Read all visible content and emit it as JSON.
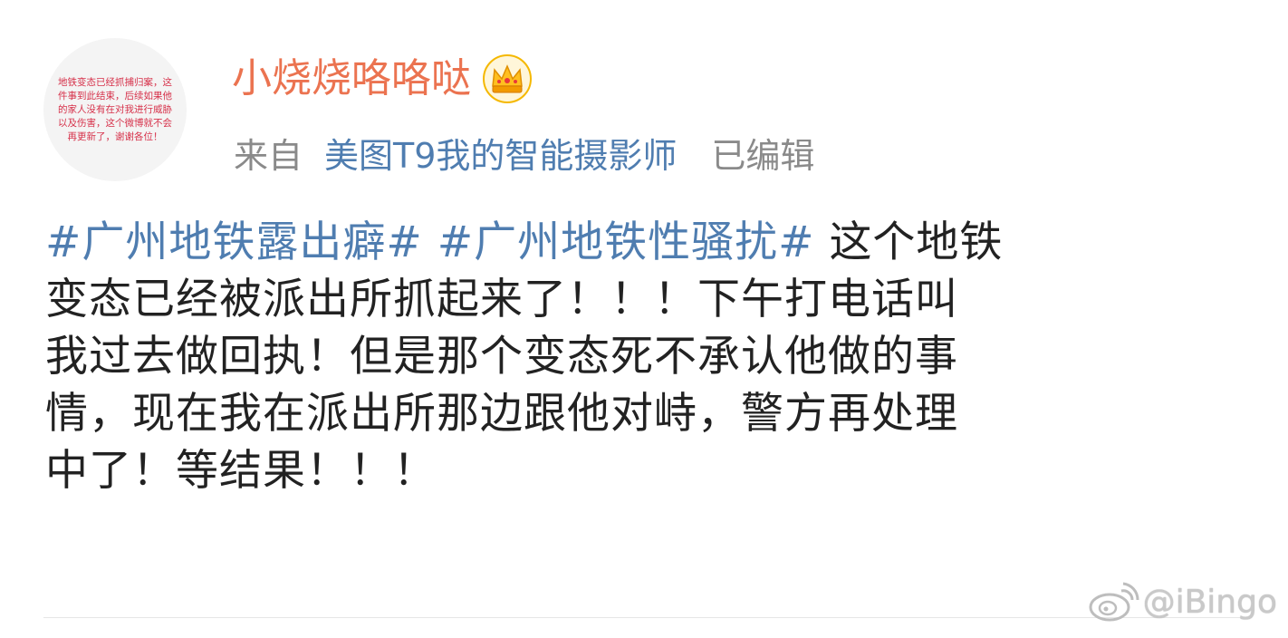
{
  "user": {
    "avatar_text": "地铁变态已经抓捕归案，这件事到此结束，后续如果他的家人没有在对我进行威胁以及伤害，这个微博就不会再更新了，谢谢各位！",
    "name": "小烧烧咯咯哒",
    "badge_icon": "crown-icon"
  },
  "meta": {
    "source_prefix": "来自",
    "source_app": "美图T9我的智能摄影师",
    "edited_label": "已编辑"
  },
  "post": {
    "line1": {
      "tag1": "#广州地铁露出癖#",
      "tag2": "#广州地铁性骚扰#",
      "text": "这个地铁"
    },
    "line2": "变态已经被派出所抓起来了！！！下午打电话叫",
    "line3": "我过去做回执！但是那个变态死不承认他做的事",
    "line4": "情，现在我在派出所那边跟他对峙，警方再处理",
    "line5": "中了！等结果！！！"
  },
  "watermark": {
    "text": "@iBingo",
    "icon": "weibo-logo-icon"
  },
  "colors": {
    "username": "#eb7350",
    "link": "#4f7db0",
    "muted": "#8a8a8a",
    "body": "#222222"
  }
}
